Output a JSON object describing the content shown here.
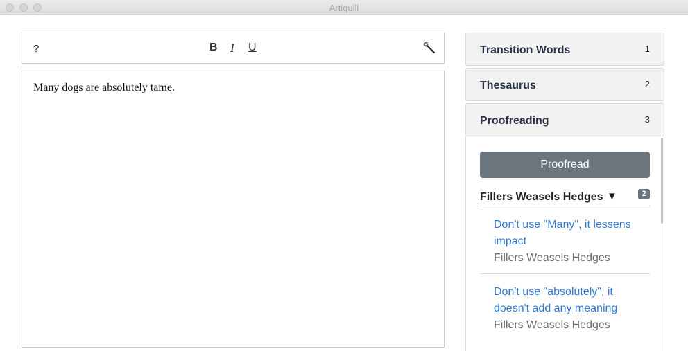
{
  "window": {
    "title": "Artiquill"
  },
  "toolbar": {
    "help_label": "?",
    "bold_label": "B",
    "italic_label": "I",
    "underline_label": "U"
  },
  "editor": {
    "content": "Many dogs are absolutely tame."
  },
  "sidebar": {
    "panels": [
      {
        "label": "Transition Words",
        "number": "1"
      },
      {
        "label": "Thesaurus",
        "number": "2"
      },
      {
        "label": "Proofreading",
        "number": "3"
      }
    ],
    "proofreading": {
      "button_label": "Proofread",
      "section": {
        "label": "Fillers Weasels Hedges",
        "arrow": "▼",
        "count": "2"
      },
      "suggestions": [
        {
          "message": "Don't use \"Many\", it lessens impact",
          "category": "Fillers Weasels Hedges"
        },
        {
          "message": "Don't use \"absolutely\", it doesn't add any meaning",
          "category": "Fillers Weasels Hedges"
        }
      ]
    }
  },
  "colors": {
    "link_blue": "#2f7ad6",
    "button_gray": "#6c757d",
    "heading_navy": "#2b3347"
  },
  "icons": {
    "wand": "magic-wand-icon"
  }
}
